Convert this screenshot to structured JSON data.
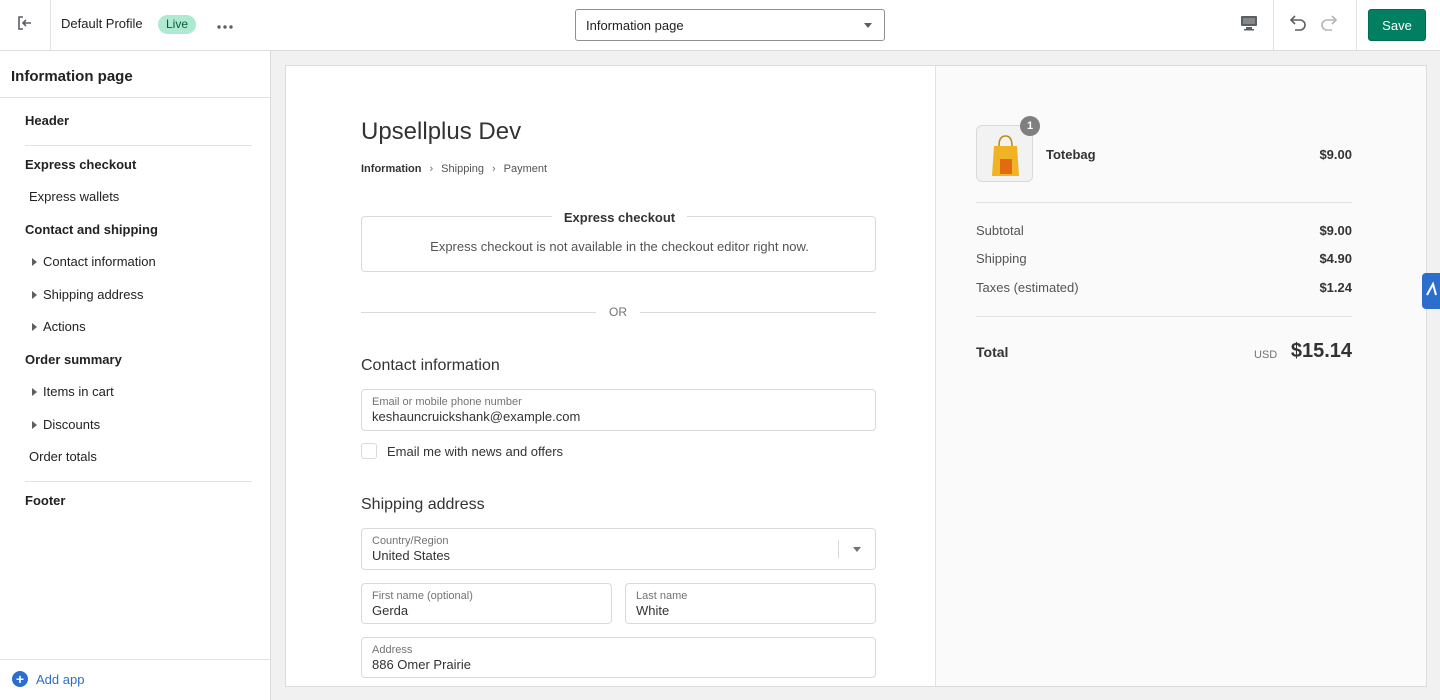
{
  "topbar": {
    "profile_name": "Default Profile",
    "live_badge": "Live",
    "page_select_value": "Information page",
    "save_label": "Save",
    "colors": {
      "save": "#008060",
      "live_bg": "#aee9d1"
    }
  },
  "sidebar": {
    "title": "Information page",
    "sections": {
      "header": "Header",
      "express_checkout": "Express checkout",
      "express_wallets": "Express wallets",
      "contact_shipping": "Contact and shipping",
      "contact_information": "Contact information",
      "shipping_address": "Shipping address",
      "actions": "Actions",
      "order_summary": "Order summary",
      "items_in_cart": "Items in cart",
      "discounts": "Discounts",
      "order_totals": "Order totals",
      "footer": "Footer"
    },
    "add_app": "Add app"
  },
  "checkout": {
    "shop_name": "Upsellplus Dev",
    "breadcrumb": [
      "Information",
      "Shipping",
      "Payment"
    ],
    "express_title": "Express checkout",
    "express_message": "Express checkout is not available in the checkout editor right now.",
    "or_label": "OR",
    "contact_heading": "Contact information",
    "email_label": "Email or mobile phone number",
    "email_value": "keshauncruickshank@example.com",
    "newsletter_label": "Email me with news and offers",
    "shipping_heading": "Shipping address",
    "country_label": "Country/Region",
    "country_value": "United States",
    "first_name_label": "First name (optional)",
    "first_name_value": "Gerda",
    "last_name_label": "Last name",
    "last_name_value": "White",
    "address_label": "Address",
    "address_value": "886 Omer Prairie"
  },
  "summary": {
    "item": {
      "name": "Totebag",
      "price": "$9.00",
      "quantity": "1"
    },
    "subtotal_label": "Subtotal",
    "subtotal_value": "$9.00",
    "shipping_label": "Shipping",
    "shipping_value": "$4.90",
    "taxes_label": "Taxes (estimated)",
    "taxes_value": "$1.24",
    "total_label": "Total",
    "total_currency": "USD",
    "total_value": "$15.14"
  }
}
